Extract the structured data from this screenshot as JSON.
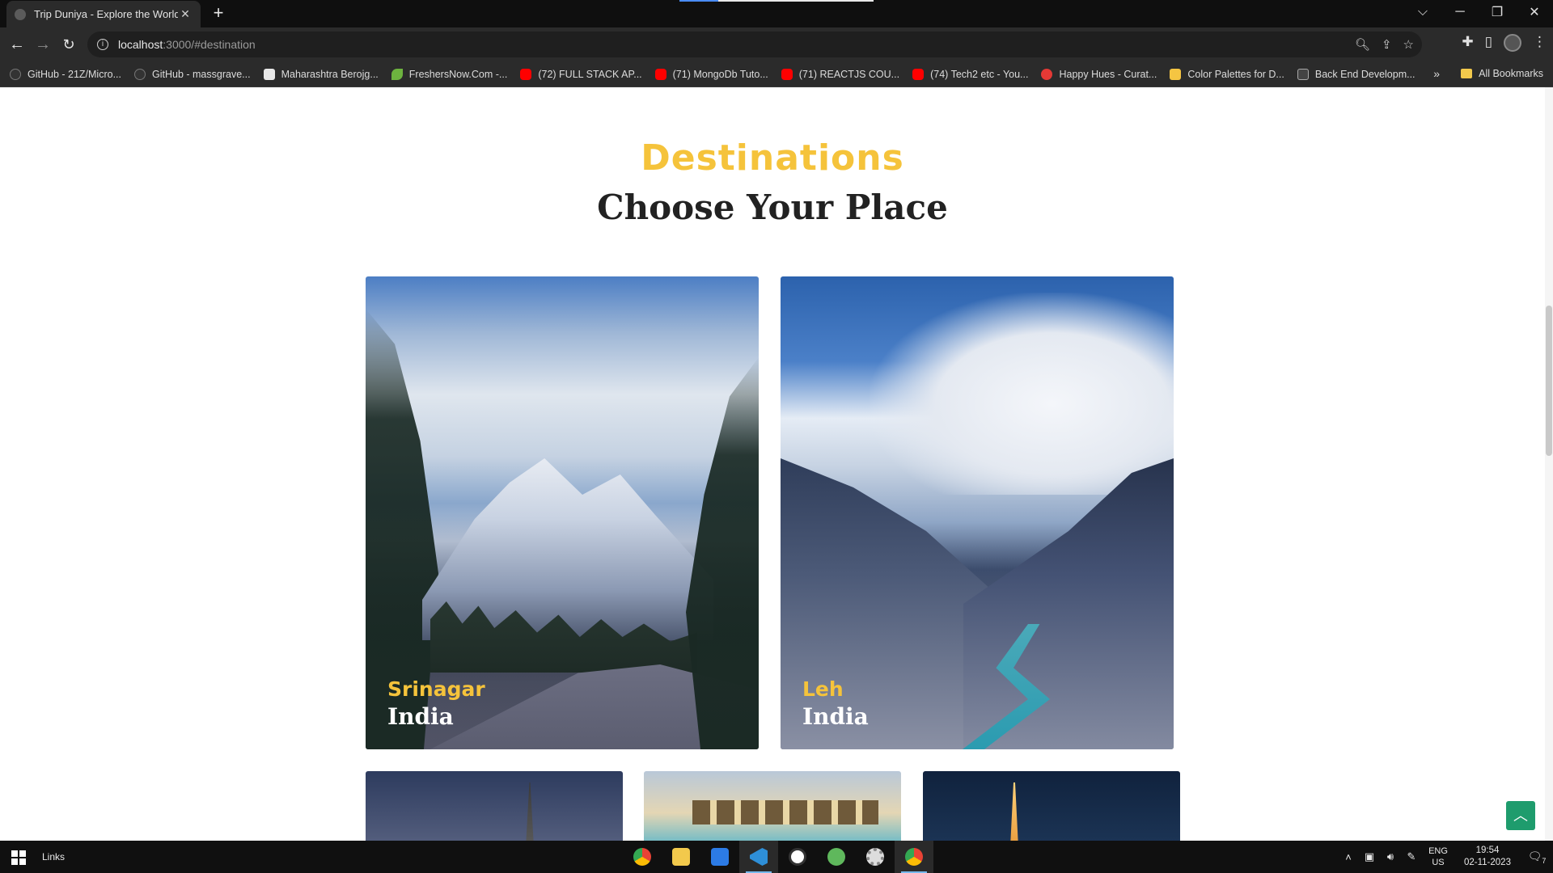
{
  "browser": {
    "tab_title": "Trip Duniya - Explore the World",
    "tab_close": "✕",
    "new_tab": "+",
    "url_host": "localhost",
    "url_rest": ":3000/#destination",
    "win_controls": [
      "⌵",
      "─",
      "❐",
      "✕"
    ],
    "bookmarks": [
      {
        "label": "GitHub - 21Z/Micro...",
        "icon": "github-icon"
      },
      {
        "label": "GitHub - massgrave...",
        "icon": "github-icon"
      },
      {
        "label": "Maharashtra Berojg...",
        "icon": "map-icon"
      },
      {
        "label": "FreshersNow.Com -...",
        "icon": "leaf-icon"
      },
      {
        "label": "(72) FULL STACK AP...",
        "icon": "youtube-icon"
      },
      {
        "label": "(71) MongoDb Tuto...",
        "icon": "youtube-icon"
      },
      {
        "label": "(71) REACTJS COU...",
        "icon": "youtube-icon"
      },
      {
        "label": "(74) Tech2 etc - You...",
        "icon": "youtube-icon"
      },
      {
        "label": "Happy Hues - Curat...",
        "icon": "happy-hues-icon"
      },
      {
        "label": "Color Palettes for D...",
        "icon": "palette-icon"
      },
      {
        "label": "Back End Developm...",
        "icon": "backend-icon"
      }
    ],
    "bookmarks_more": "»",
    "all_bookmarks": "All Bookmarks"
  },
  "section": {
    "kicker": "Destinations",
    "title": "Choose Your Place"
  },
  "destinations": [
    {
      "city": "Srinagar",
      "country": "India"
    },
    {
      "city": "Leh",
      "country": "India"
    }
  ],
  "back_to_top_icon": "chevron-up-icon",
  "taskbar": {
    "links_label": "Links",
    "lang_top": "ENG",
    "lang_bottom": "US",
    "time": "19:54",
    "date": "02-11-2023",
    "notif_count": "7"
  },
  "colors": {
    "accent_yellow": "#f5c33b",
    "heading_dark": "#222222",
    "back_to_top": "#1e9c6d"
  }
}
